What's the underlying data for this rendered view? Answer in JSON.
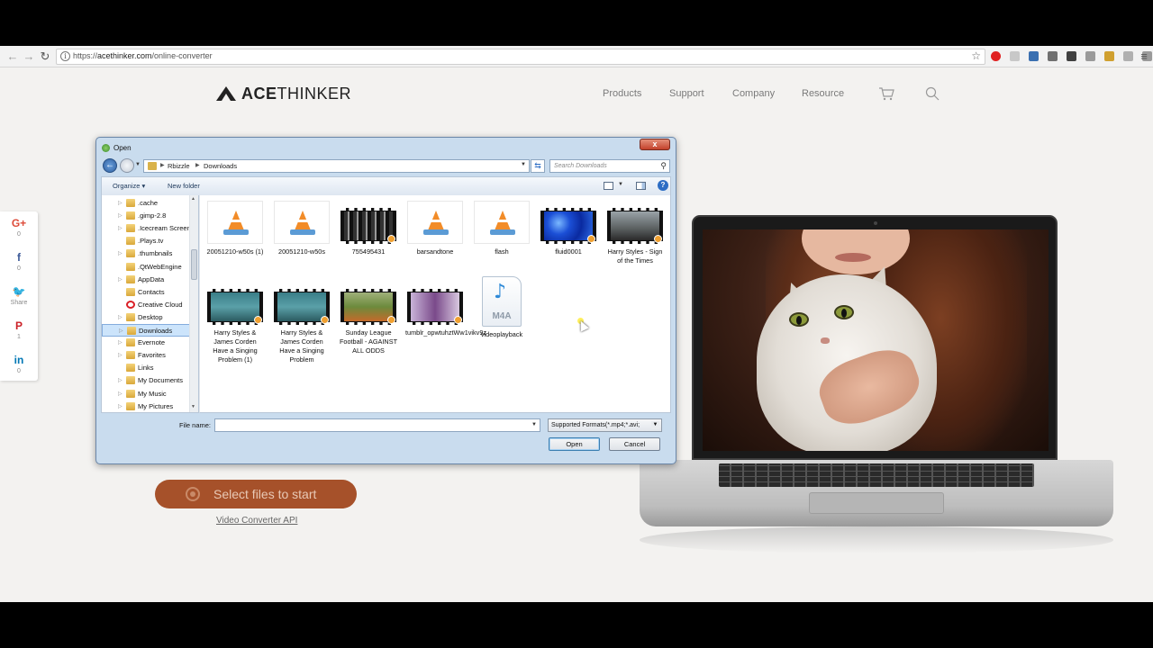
{
  "browser": {
    "url_scheme": "https://",
    "url_host": "acethinker.com",
    "url_path": "/online-converter",
    "extension_icons": [
      "opera-icon",
      "flag-icon",
      "person-icon",
      "square-icon",
      "square-icon",
      "square-icon",
      "folder-icon",
      "doc-icon",
      "gear-icon",
      "cube-icon"
    ],
    "menu_icon": "≡"
  },
  "site": {
    "logo": "ACETHINKER",
    "logo_bold": "ACE",
    "logo_rest": "THINKER",
    "nav": [
      "Products",
      "Support",
      "Company",
      "Resource"
    ]
  },
  "social": [
    {
      "icon": "G+",
      "count": "0",
      "color": "#dd4b39"
    },
    {
      "icon": "f",
      "count": "0",
      "color": "#3b5998"
    },
    {
      "icon": "🐦",
      "count": "Share",
      "color": "#1da1f2"
    },
    {
      "icon": "P",
      "count": "1",
      "color": "#cb2027"
    },
    {
      "icon": "in",
      "count": "0",
      "color": "#0077b5"
    }
  ],
  "start_button": "Select files to start",
  "api_link": "Video Converter API",
  "dialog": {
    "title": "Open",
    "path": [
      "Rbizzle",
      "Downloads"
    ],
    "search_placeholder": "Search Downloads",
    "organize": "Organize ▾",
    "new_folder": "New folder",
    "help": "?",
    "nav_items": [
      {
        "label": ".cache",
        "icon": "folder",
        "tw": "▷"
      },
      {
        "label": ".gimp-2.8",
        "icon": "folder",
        "tw": "▷"
      },
      {
        "label": ".Icecream Screen",
        "icon": "folder",
        "tw": "▷"
      },
      {
        "label": ".Plays.tv",
        "icon": "folder",
        "tw": ""
      },
      {
        "label": ".thumbnails",
        "icon": "folder",
        "tw": "▷"
      },
      {
        "label": ".QtWebEngine",
        "icon": "folder",
        "tw": ""
      },
      {
        "label": "AppData",
        "icon": "folder",
        "tw": "▷"
      },
      {
        "label": "Contacts",
        "icon": "folder",
        "tw": ""
      },
      {
        "label": "Creative Cloud",
        "icon": "cc",
        "tw": ""
      },
      {
        "label": "Desktop",
        "icon": "folder",
        "tw": "▷"
      },
      {
        "label": "Downloads",
        "icon": "folder",
        "tw": "▷",
        "selected": true
      },
      {
        "label": "Evernote",
        "icon": "folder",
        "tw": "▷"
      },
      {
        "label": "Favorites",
        "icon": "folder",
        "tw": "▷"
      },
      {
        "label": "Links",
        "icon": "folder",
        "tw": ""
      },
      {
        "label": "My Documents",
        "icon": "folder",
        "tw": "▷"
      },
      {
        "label": "My Music",
        "icon": "folder",
        "tw": "▷"
      },
      {
        "label": "My Pictures",
        "icon": "folder",
        "tw": "▷"
      }
    ],
    "files": [
      {
        "name": "20051210-w50s (1)",
        "kind": "vlc"
      },
      {
        "name": "20051210-w50s",
        "kind": "vlc"
      },
      {
        "name": "755495431",
        "kind": "video",
        "scene": "mosaic"
      },
      {
        "name": "barsandtone",
        "kind": "vlc"
      },
      {
        "name": "flash",
        "kind": "vlc"
      },
      {
        "name": "fluid0001",
        "kind": "video",
        "scene": "water"
      },
      {
        "name": "Harry Styles - Sign of the Times",
        "kind": "video",
        "scene": "dusk"
      },
      {
        "name": "Harry Styles & James Corden Have a Singing Problem (1)",
        "kind": "video",
        "scene": "teal"
      },
      {
        "name": "Harry Styles & James Corden Have a Singing Problem",
        "kind": "video",
        "scene": "teal"
      },
      {
        "name": "Sunday League Football - AGAINST ALL ODDS",
        "kind": "video",
        "scene": "field"
      },
      {
        "name": "tumblr_opwtuhztWw1vikv9z",
        "kind": "video",
        "scene": "purple"
      },
      {
        "name": "videoplayback",
        "kind": "m4a",
        "label": "M4A"
      }
    ],
    "file_name_label": "File name:",
    "file_name_value": "",
    "filter": "Supported Formats(*.mp4;*.avi;",
    "open_button": "Open",
    "cancel_button": "Cancel",
    "close_button": "x"
  }
}
